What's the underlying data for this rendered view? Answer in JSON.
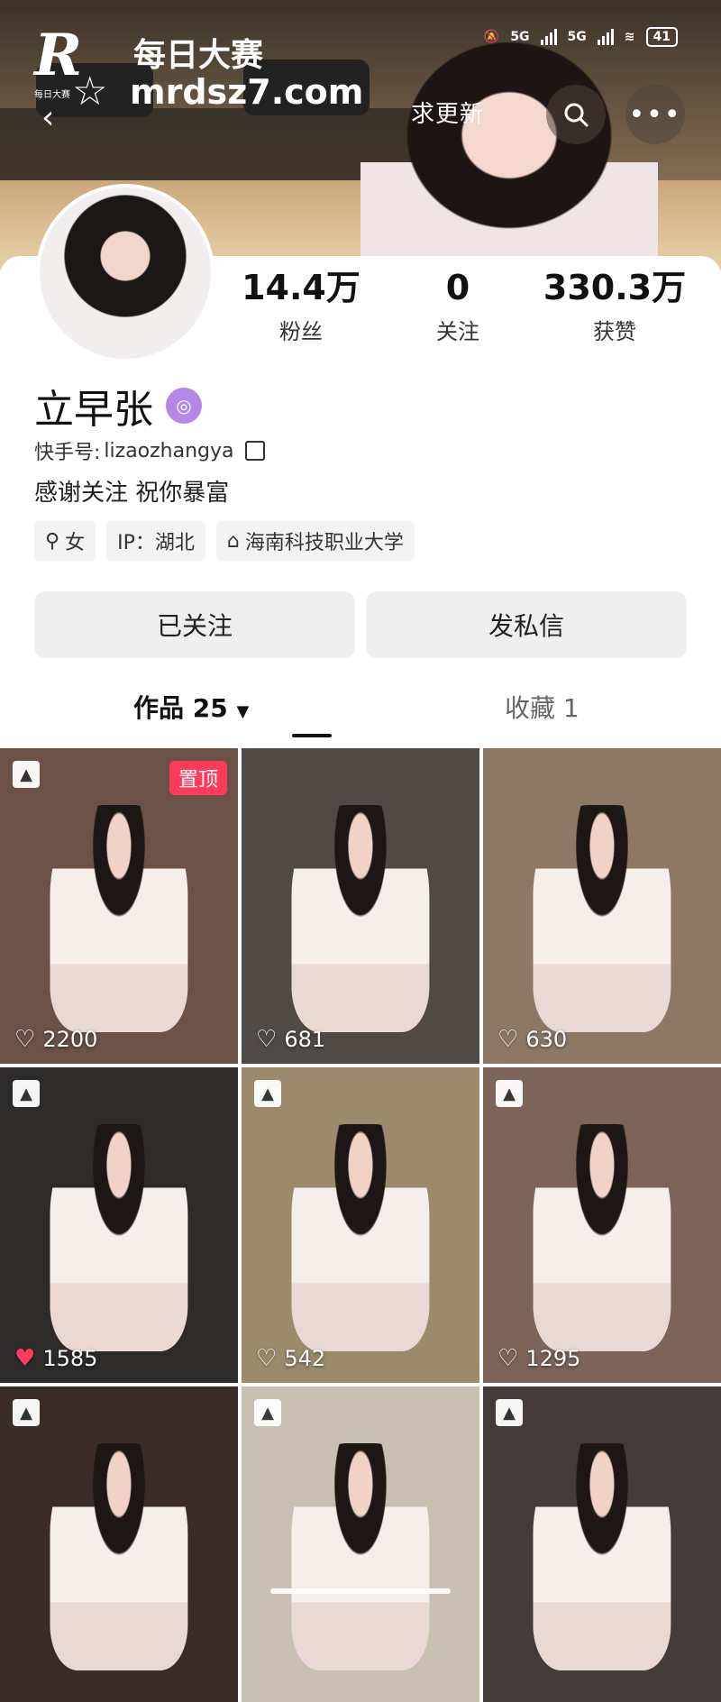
{
  "status": {
    "network_1": "5G",
    "network_2": "5G",
    "battery": "41"
  },
  "watermark": {
    "letter": "R",
    "title": "每日大赛",
    "url": "mrdsz7.com",
    "small": "每日大赛"
  },
  "header": {
    "update_label": "求更新"
  },
  "profile": {
    "name": "立早张",
    "kuaishou_label": "快手号:",
    "kuaishou_id": "lizaozhangya",
    "bio": "感谢关注 祝你暴富",
    "tags": [
      {
        "icon": "female-icon",
        "text": "女"
      },
      {
        "icon": "",
        "text": "IP：湖北"
      },
      {
        "icon": "graduation-cap-icon",
        "text": "海南科技职业大学"
      }
    ],
    "stats": [
      {
        "value": "14.4万",
        "label": "粉丝"
      },
      {
        "value": "0",
        "label": "关注"
      },
      {
        "value": "330.3万",
        "label": "获赞"
      }
    ]
  },
  "actions": {
    "followed": "已关注",
    "message": "发私信"
  },
  "tabs": {
    "works": "作品 25",
    "favorites": "收藏 1"
  },
  "posts": [
    {
      "likes": "2200",
      "pinned": "置顶",
      "liked": false,
      "bg": "#6b5146"
    },
    {
      "likes": "681",
      "liked": false,
      "bg": "#4f4a46"
    },
    {
      "likes": "630",
      "liked": false,
      "bg": "#8d7865"
    },
    {
      "likes": "1585",
      "liked": true,
      "bg": "#2d2a2a"
    },
    {
      "likes": "542",
      "liked": false,
      "bg": "#9b8b6c"
    },
    {
      "likes": "1295",
      "liked": false,
      "bg": "#7c6458"
    },
    {
      "likes": "",
      "liked": false,
      "bg": "#3a2d29"
    },
    {
      "likes": "",
      "liked": false,
      "bg": "#c8c0b3"
    },
    {
      "likes": "",
      "liked": false,
      "bg": "#433c3a"
    }
  ]
}
